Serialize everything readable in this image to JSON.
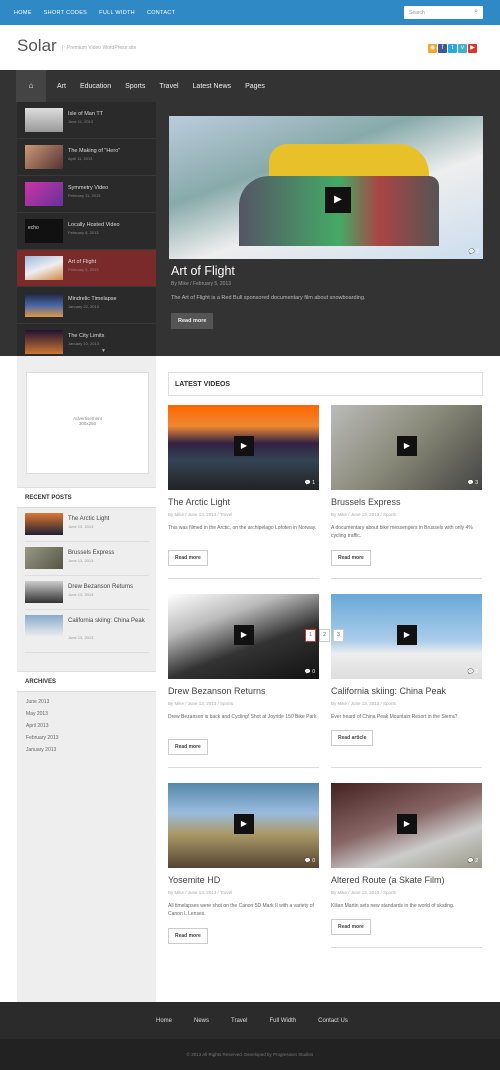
{
  "topbar": {
    "nav": [
      "HOME",
      "SHORT CODES",
      "FULL WIDTH",
      "CONTACT"
    ],
    "search_placeholder": "Search"
  },
  "header": {
    "logo": "Solar",
    "tagline": "Premium Video WordPress site",
    "social_icons": [
      "rss-icon",
      "facebook-icon",
      "twitter-icon",
      "vimeo-icon",
      "youtube-icon"
    ],
    "social_colors": [
      "#f4a52a",
      "#3b5998",
      "#29a9e1",
      "#44b0c9",
      "#d33"
    ]
  },
  "mainnav": {
    "items": [
      "Art",
      "Education",
      "Sports",
      "Travel",
      "Latest News",
      "Pages"
    ]
  },
  "slider_list": [
    {
      "title": "Isle of Man TT",
      "date": "June 11, 2013"
    },
    {
      "title": "The Making of \"Hero\"",
      "date": "April 11, 2013"
    },
    {
      "title": "Symmetry Video",
      "date": "February 11, 2013"
    },
    {
      "title": "Locally Hosted Video",
      "date": "February 8, 2013"
    },
    {
      "title": "Art of Flight",
      "date": "February 5, 2013"
    },
    {
      "title": "Mindrelic Timelapse",
      "date": "January 22, 2013"
    },
    {
      "title": "The City Limits",
      "date": "January 10, 2013"
    }
  ],
  "feature": {
    "title": "Art of Flight",
    "meta": "By Mike / February 5, 2013",
    "desc": "The Art of Flight is a Red Bull sponsored documentary film about snowboarding.",
    "button": "Read more",
    "comments": "2"
  },
  "sidebar": {
    "ad_line1": "Advertisement",
    "ad_line2": "300x250",
    "recent_title": "RECENT POSTS",
    "recent": [
      {
        "title": "The Arctic Light",
        "date": "June 13, 2013"
      },
      {
        "title": "Brussels Express",
        "date": "June 13, 2013"
      },
      {
        "title": "Drew Bezanson Returns",
        "date": "June 13, 2013"
      },
      {
        "title": "California skiing: China Peak",
        "date": "June 13, 2013"
      }
    ],
    "archives_title": "ARCHIVES",
    "archives": [
      "June 2013",
      "May 2013",
      "April 2013",
      "February 2013",
      "January 2013"
    ]
  },
  "latest": {
    "heading": "LATEST VIDEOS",
    "cards": [
      {
        "title": "The Arctic Light",
        "meta": "By Mike / June 13, 2013 / Travel",
        "desc": "This was filmed in the Arctic, on the archipelago Lofoten in Norway.",
        "button": "Read more",
        "comments": "1"
      },
      {
        "title": "Brussels Express",
        "meta": "By Mike / June 13, 2013 / Sports",
        "desc": "A documentary about bike messengers in Brussels with only 4% cycling traffic.",
        "button": "Read more",
        "comments": "3"
      },
      {
        "title": "Drew Bezanson Returns",
        "meta": "By Mike / June 13, 2013 / Sports",
        "desc": "Drew Bezanson is back and Cycling! Shot at Joyride 150 Bike Park",
        "button": "Read more",
        "comments": "0"
      },
      {
        "title": "California skiing: China Peak",
        "meta": "By Mike / June 13, 2013 / Sports",
        "desc": "Ever heard of China Peak Mountain Resort in the Sierra?",
        "button": "Read article",
        "comments": "2"
      },
      {
        "title": "Yosemite HD",
        "meta": "By Mike / June 13, 2013 / Travel",
        "desc": "All timelapses were shot on the Canon 5D Mark II with a variety of Canon L Lenses.",
        "button": "Read more",
        "comments": "0"
      },
      {
        "title": "Altered Route (a Skate Film)",
        "meta": "By Mike / June 13, 2013 / Sports",
        "desc": "Kilian Martin sets new standards in the world of skating.",
        "button": "Read more",
        "comments": "2"
      }
    ],
    "pages": [
      "1",
      "2",
      "3"
    ]
  },
  "footer": {
    "nav": [
      "Home",
      "News",
      "Travel",
      "Full Width",
      "Contact Us"
    ],
    "copyright": "© 2013 All Rights Reserved. Developed by Progression Studios"
  }
}
